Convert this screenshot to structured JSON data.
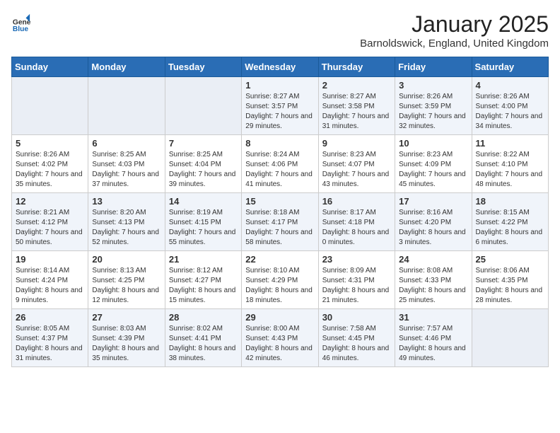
{
  "header": {
    "logo_general": "General",
    "logo_blue": "Blue",
    "title": "January 2025",
    "subtitle": "Barnoldswick, England, United Kingdom"
  },
  "weekdays": [
    "Sunday",
    "Monday",
    "Tuesday",
    "Wednesday",
    "Thursday",
    "Friday",
    "Saturday"
  ],
  "weeks": [
    [
      {
        "day": "",
        "sunrise": "",
        "sunset": "",
        "daylight": ""
      },
      {
        "day": "",
        "sunrise": "",
        "sunset": "",
        "daylight": ""
      },
      {
        "day": "",
        "sunrise": "",
        "sunset": "",
        "daylight": ""
      },
      {
        "day": "1",
        "sunrise": "Sunrise: 8:27 AM",
        "sunset": "Sunset: 3:57 PM",
        "daylight": "Daylight: 7 hours and 29 minutes."
      },
      {
        "day": "2",
        "sunrise": "Sunrise: 8:27 AM",
        "sunset": "Sunset: 3:58 PM",
        "daylight": "Daylight: 7 hours and 31 minutes."
      },
      {
        "day": "3",
        "sunrise": "Sunrise: 8:26 AM",
        "sunset": "Sunset: 3:59 PM",
        "daylight": "Daylight: 7 hours and 32 minutes."
      },
      {
        "day": "4",
        "sunrise": "Sunrise: 8:26 AM",
        "sunset": "Sunset: 4:00 PM",
        "daylight": "Daylight: 7 hours and 34 minutes."
      }
    ],
    [
      {
        "day": "5",
        "sunrise": "Sunrise: 8:26 AM",
        "sunset": "Sunset: 4:02 PM",
        "daylight": "Daylight: 7 hours and 35 minutes."
      },
      {
        "day": "6",
        "sunrise": "Sunrise: 8:25 AM",
        "sunset": "Sunset: 4:03 PM",
        "daylight": "Daylight: 7 hours and 37 minutes."
      },
      {
        "day": "7",
        "sunrise": "Sunrise: 8:25 AM",
        "sunset": "Sunset: 4:04 PM",
        "daylight": "Daylight: 7 hours and 39 minutes."
      },
      {
        "day": "8",
        "sunrise": "Sunrise: 8:24 AM",
        "sunset": "Sunset: 4:06 PM",
        "daylight": "Daylight: 7 hours and 41 minutes."
      },
      {
        "day": "9",
        "sunrise": "Sunrise: 8:23 AM",
        "sunset": "Sunset: 4:07 PM",
        "daylight": "Daylight: 7 hours and 43 minutes."
      },
      {
        "day": "10",
        "sunrise": "Sunrise: 8:23 AM",
        "sunset": "Sunset: 4:09 PM",
        "daylight": "Daylight: 7 hours and 45 minutes."
      },
      {
        "day": "11",
        "sunrise": "Sunrise: 8:22 AM",
        "sunset": "Sunset: 4:10 PM",
        "daylight": "Daylight: 7 hours and 48 minutes."
      }
    ],
    [
      {
        "day": "12",
        "sunrise": "Sunrise: 8:21 AM",
        "sunset": "Sunset: 4:12 PM",
        "daylight": "Daylight: 7 hours and 50 minutes."
      },
      {
        "day": "13",
        "sunrise": "Sunrise: 8:20 AM",
        "sunset": "Sunset: 4:13 PM",
        "daylight": "Daylight: 7 hours and 52 minutes."
      },
      {
        "day": "14",
        "sunrise": "Sunrise: 8:19 AM",
        "sunset": "Sunset: 4:15 PM",
        "daylight": "Daylight: 7 hours and 55 minutes."
      },
      {
        "day": "15",
        "sunrise": "Sunrise: 8:18 AM",
        "sunset": "Sunset: 4:17 PM",
        "daylight": "Daylight: 7 hours and 58 minutes."
      },
      {
        "day": "16",
        "sunrise": "Sunrise: 8:17 AM",
        "sunset": "Sunset: 4:18 PM",
        "daylight": "Daylight: 8 hours and 0 minutes."
      },
      {
        "day": "17",
        "sunrise": "Sunrise: 8:16 AM",
        "sunset": "Sunset: 4:20 PM",
        "daylight": "Daylight: 8 hours and 3 minutes."
      },
      {
        "day": "18",
        "sunrise": "Sunrise: 8:15 AM",
        "sunset": "Sunset: 4:22 PM",
        "daylight": "Daylight: 8 hours and 6 minutes."
      }
    ],
    [
      {
        "day": "19",
        "sunrise": "Sunrise: 8:14 AM",
        "sunset": "Sunset: 4:24 PM",
        "daylight": "Daylight: 8 hours and 9 minutes."
      },
      {
        "day": "20",
        "sunrise": "Sunrise: 8:13 AM",
        "sunset": "Sunset: 4:25 PM",
        "daylight": "Daylight: 8 hours and 12 minutes."
      },
      {
        "day": "21",
        "sunrise": "Sunrise: 8:12 AM",
        "sunset": "Sunset: 4:27 PM",
        "daylight": "Daylight: 8 hours and 15 minutes."
      },
      {
        "day": "22",
        "sunrise": "Sunrise: 8:10 AM",
        "sunset": "Sunset: 4:29 PM",
        "daylight": "Daylight: 8 hours and 18 minutes."
      },
      {
        "day": "23",
        "sunrise": "Sunrise: 8:09 AM",
        "sunset": "Sunset: 4:31 PM",
        "daylight": "Daylight: 8 hours and 21 minutes."
      },
      {
        "day": "24",
        "sunrise": "Sunrise: 8:08 AM",
        "sunset": "Sunset: 4:33 PM",
        "daylight": "Daylight: 8 hours and 25 minutes."
      },
      {
        "day": "25",
        "sunrise": "Sunrise: 8:06 AM",
        "sunset": "Sunset: 4:35 PM",
        "daylight": "Daylight: 8 hours and 28 minutes."
      }
    ],
    [
      {
        "day": "26",
        "sunrise": "Sunrise: 8:05 AM",
        "sunset": "Sunset: 4:37 PM",
        "daylight": "Daylight: 8 hours and 31 minutes."
      },
      {
        "day": "27",
        "sunrise": "Sunrise: 8:03 AM",
        "sunset": "Sunset: 4:39 PM",
        "daylight": "Daylight: 8 hours and 35 minutes."
      },
      {
        "day": "28",
        "sunrise": "Sunrise: 8:02 AM",
        "sunset": "Sunset: 4:41 PM",
        "daylight": "Daylight: 8 hours and 38 minutes."
      },
      {
        "day": "29",
        "sunrise": "Sunrise: 8:00 AM",
        "sunset": "Sunset: 4:43 PM",
        "daylight": "Daylight: 8 hours and 42 minutes."
      },
      {
        "day": "30",
        "sunrise": "Sunrise: 7:58 AM",
        "sunset": "Sunset: 4:45 PM",
        "daylight": "Daylight: 8 hours and 46 minutes."
      },
      {
        "day": "31",
        "sunrise": "Sunrise: 7:57 AM",
        "sunset": "Sunset: 4:46 PM",
        "daylight": "Daylight: 8 hours and 49 minutes."
      },
      {
        "day": "",
        "sunrise": "",
        "sunset": "",
        "daylight": ""
      }
    ]
  ]
}
